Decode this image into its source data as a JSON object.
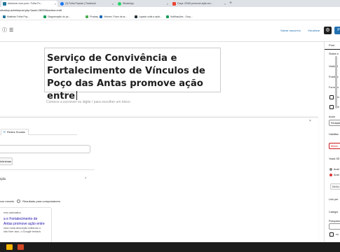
{
  "browser": {
    "tabs": [
      {
        "label": "Adicionar novo post ‹ Folha Po...",
        "active": true,
        "favicon_color": "#21759b"
      },
      {
        "label": "(2) Folha Popular | Facebook",
        "active": false,
        "favicon_color": "#1877f2"
      },
      {
        "label": "WhatsApp",
        "active": false,
        "favicon_color": "#25d366"
      },
      {
        "label": "Ouça: CRAS promove ação em...",
        "active": false,
        "favicon_color": "#ea4335"
      }
    ],
    "new_tab_label": "+",
    "address": "olha/wp-admin/post.php?post=28255&action=edit",
    "bookmarks": [
      {
        "label": "Matérias Folha Pop...",
        "color": "#21759b"
      },
      {
        "label": "Diagramação do jor...",
        "color": "#0f9d58"
      },
      {
        "label": "Pixabay",
        "color": "#4caf50"
      },
      {
        "label": "Vetores, Fotos de ar...",
        "color": "#1565c0"
      },
      {
        "label": "Lapado sofia a aplic...",
        "color": "#263238"
      },
      {
        "label": "Notificações - Grup...",
        "color": "#0f9d58"
      }
    ]
  },
  "toolbar": {
    "info_icon": "info-icon",
    "list_view_icon": "list-view-icon",
    "save_draft_label": "Salvar rascunho",
    "preview_label": "Visualizar",
    "settings_icon": "settings-icon",
    "publish_label": "P"
  },
  "editor": {
    "post_title": "Serviço de Convivência e Fortalecimento de Vínculos de Poço das Antas promove ação entre",
    "paragraph_placeholder": "Comece a escrever ou digite / para escolher um bloco"
  },
  "yoast": {
    "close_icon": "×",
    "social_tab_label": "Redes Sociais",
    "related_button_label": "inônimas",
    "section_label": "ição",
    "section_chevron": "⌃",
    "radio_mobile_label": "vos móveis",
    "radio_desktop_label": "Resultado para computadores",
    "serp_site": "ento automatico",
    "serp_title": "a e Fortalecimento de\n Antas promove ação entre",
    "serp_desc": "uma meta descrição editando o\nnão fizer isso, o Google tentará"
  },
  "sidebar": {
    "tab_label": "Post",
    "items": [
      {
        "label": "Status e",
        "kind": "label"
      },
      {
        "label": "Visibilid",
        "kind": "label"
      },
      {
        "label": "Publicar",
        "kind": "label"
      },
      {
        "label": "Formato",
        "kind": "label"
      },
      {
        "label": "Fix",
        "kind": "checkbox"
      },
      {
        "label": "Re",
        "kind": "checkbox"
      },
      {
        "label": "Autor",
        "kind": "label"
      },
      {
        "label": "Redação",
        "kind": "field"
      },
      {
        "label": "Habilitar",
        "kind": "label"
      },
      {
        "label": "Mover",
        "kind": "danger-button"
      },
      {
        "label": "Yoast SE",
        "kind": "label"
      },
      {
        "label": "Anál",
        "kind": "dot",
        "color": "#888888"
      },
      {
        "label": "Anál",
        "kind": "dot",
        "color": "#dc3232"
      },
      {
        "label": "Melho",
        "kind": "button"
      },
      {
        "label": "Link per",
        "kind": "label"
      },
      {
        "label": "Categor",
        "kind": "label"
      },
      {
        "label": "Pesquisa",
        "kind": "label"
      },
      {
        "label": "co",
        "kind": "checkbox"
      }
    ]
  },
  "taskbar": {
    "apps": [
      {
        "name": "file-explorer-icon",
        "color": "#f4b400"
      },
      {
        "name": "office-icon",
        "color": "#d24726"
      }
    ]
  }
}
